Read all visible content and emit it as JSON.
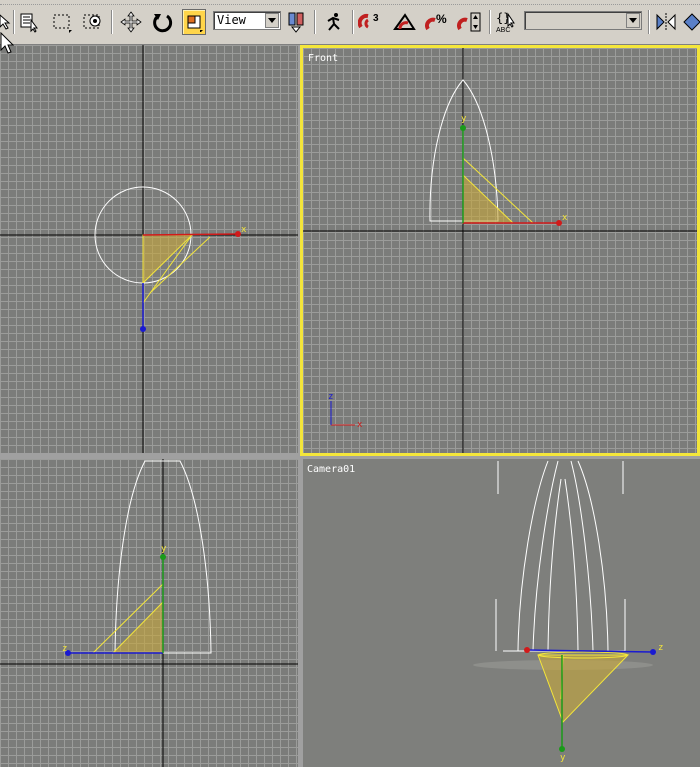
{
  "toolbar": {
    "view_dropdown": "View",
    "named_selection": "",
    "icons": [
      "select-by-name-icon",
      "rectangular-selection-icon",
      "window-crossing-icon",
      "move-icon",
      "rotate-icon",
      "scale-icon",
      "mirror-icon",
      "align-icon"
    ]
  },
  "viewports": {
    "top": {
      "label": ""
    },
    "front": {
      "label": "Front"
    },
    "left": {
      "label": ""
    },
    "camera": {
      "label": "Camera01"
    }
  },
  "axes": {
    "x": "x",
    "y": "y",
    "z": "z"
  },
  "colors": {
    "selection_yellow": "#f4e63a",
    "light_fill": "#c8a83a",
    "gizmo_x": "#d11a1a",
    "gizmo_y": "#1a9a1a",
    "gizmo_z": "#1a1ad1"
  }
}
